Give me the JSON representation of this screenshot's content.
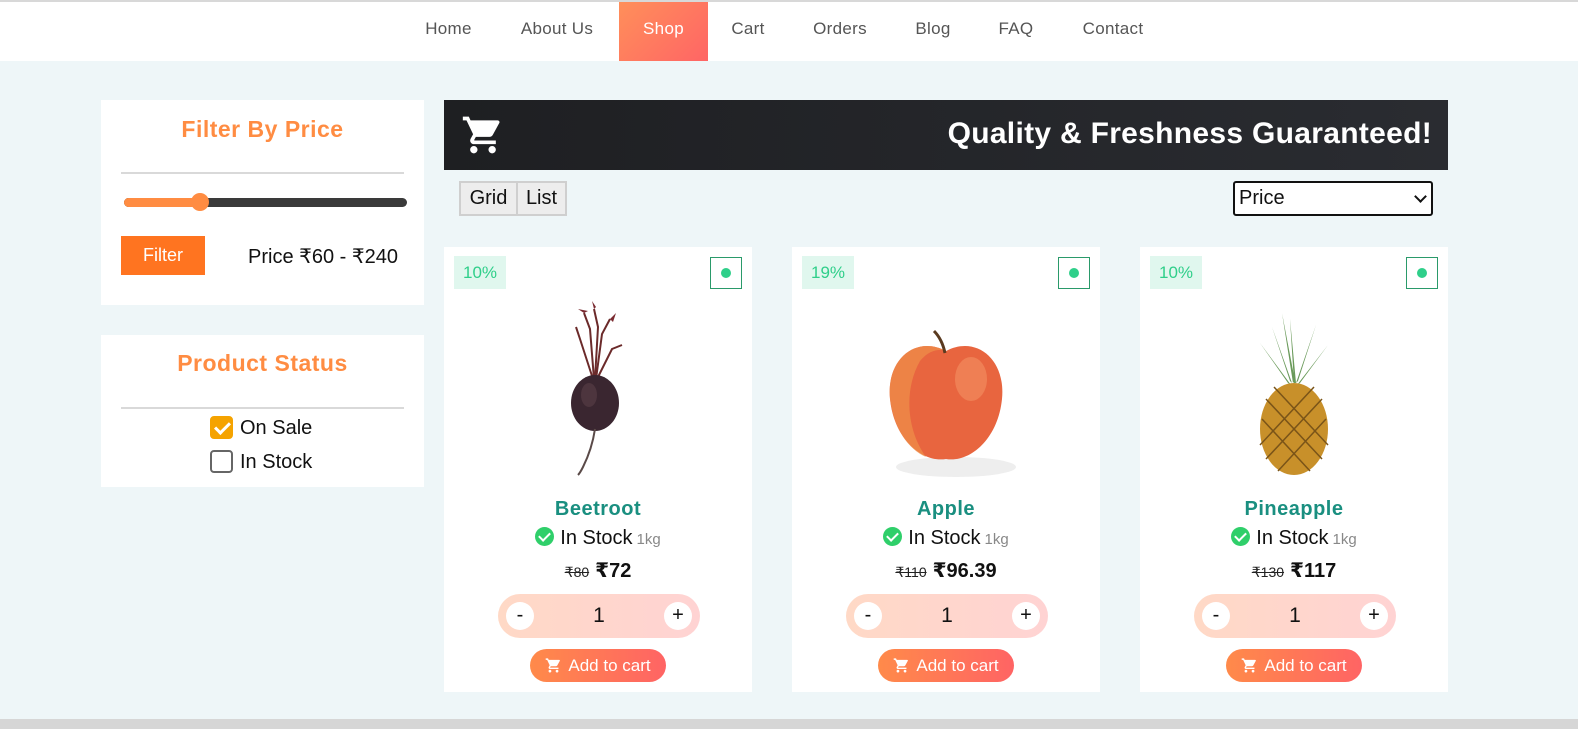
{
  "nav": {
    "items": [
      {
        "label": "Home",
        "active": false
      },
      {
        "label": "About Us",
        "active": false
      },
      {
        "label": "Shop",
        "active": true
      },
      {
        "label": "Cart",
        "active": false
      },
      {
        "label": "Orders",
        "active": false
      },
      {
        "label": "Blog",
        "active": false
      },
      {
        "label": "FAQ",
        "active": false
      },
      {
        "label": "Contact",
        "active": false
      }
    ]
  },
  "sidebar": {
    "price_filter": {
      "title": "Filter By Price",
      "button_label": "Filter",
      "range_text": "Price ₹60 - ₹240",
      "slider_level": 0.27
    },
    "status_filter": {
      "title": "Product Status",
      "options": [
        {
          "label": "On Sale",
          "checked": true
        },
        {
          "label": "In Stock",
          "checked": false
        }
      ]
    }
  },
  "banner": {
    "title": "Quality & Freshness Guaranteed!",
    "icon": "cart-icon"
  },
  "toolbar": {
    "grid_label": "Grid",
    "list_label": "List",
    "sort_value": "Price"
  },
  "products": [
    {
      "name": "Beetroot",
      "discount": "10%",
      "stock": "In Stock",
      "unit": "1kg",
      "old_price": "₹80",
      "price": "₹72",
      "qty": "1",
      "minus": "-",
      "plus": "+",
      "add_label": "Add to cart"
    },
    {
      "name": "Apple",
      "discount": "19%",
      "stock": "In Stock",
      "unit": "1kg",
      "old_price": "₹110",
      "price": "₹96.39",
      "qty": "1",
      "minus": "-",
      "plus": "+",
      "add_label": "Add to cart"
    },
    {
      "name": "Pineapple",
      "discount": "10%",
      "stock": "In Stock",
      "unit": "1kg",
      "old_price": "₹130",
      "price": "₹117",
      "qty": "1",
      "minus": "-",
      "plus": "+",
      "add_label": "Add to cart"
    }
  ],
  "colors": {
    "accent": "#ff8c42",
    "product_name": "#1a8f80",
    "stock_green": "#2fcf6a",
    "banner_bg": "#1e1f22"
  }
}
